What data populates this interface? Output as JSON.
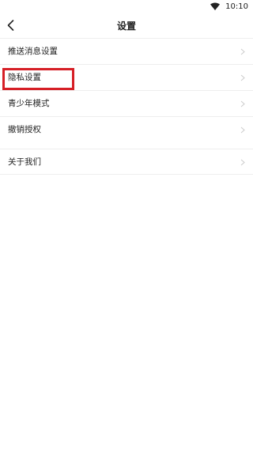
{
  "status_bar": {
    "time": "10:10"
  },
  "header": {
    "title": "设置"
  },
  "settings": {
    "items": [
      {
        "label": "推送消息设置"
      },
      {
        "label": "隐私设置"
      },
      {
        "label": "青少年模式"
      },
      {
        "label": "撤销授权"
      },
      {
        "label": "关于我们"
      }
    ]
  },
  "colors": {
    "highlight": "#d61f26",
    "divider": "#eeeeee",
    "chevron": "#cccccc"
  },
  "icons": {
    "back": "chevron-left-icon",
    "row_arrow": "chevron-right-icon",
    "wifi": "wifi-icon"
  }
}
